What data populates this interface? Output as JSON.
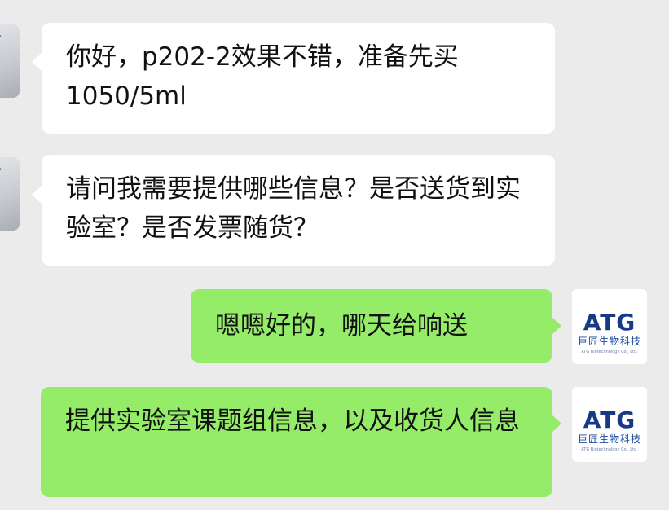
{
  "messages": [
    {
      "side": "left",
      "text": "你好，p202-2效果不错，准备先买1050/5ml"
    },
    {
      "side": "left",
      "text": "请问我需要提供哪些信息？是否送货到实验室？是否发票随货？"
    },
    {
      "side": "right",
      "text": "嗯嗯好的，哪天给响送"
    },
    {
      "side": "right",
      "text": "提供实验室课题组信息，以及收货人信息"
    }
  ],
  "brand": {
    "logo_text": "ATG",
    "cn_name": "巨匠生物科技",
    "en_name": "ATG Biotechnology Co., Ltd."
  },
  "colors": {
    "background": "#ebebeb",
    "left_bubble": "#ffffff",
    "right_bubble": "#95ec69",
    "brand": "#173a86"
  }
}
